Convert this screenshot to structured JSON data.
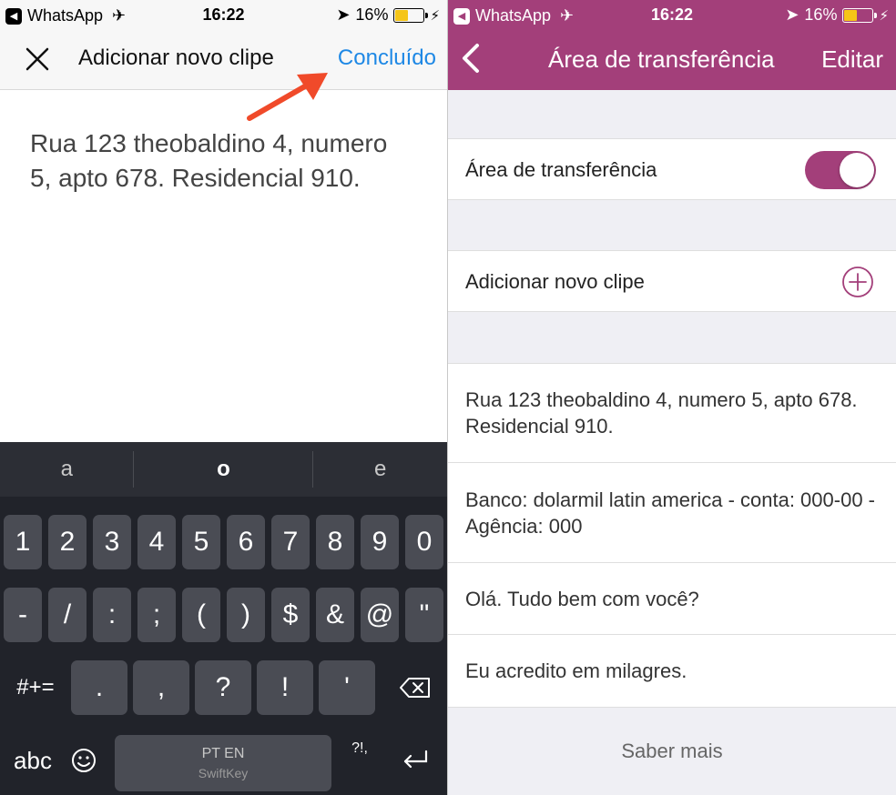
{
  "left": {
    "status": {
      "app": "WhatsApp",
      "time": "16:22",
      "battery": "16%"
    },
    "nav": {
      "title": "Adicionar novo clipe",
      "done_label": "Concluído"
    },
    "clip_text": "Rua 123 theobaldino 4, numero 5, apto 678. Residencial 910.",
    "keyboard": {
      "suggestions": [
        "a",
        "o",
        "e"
      ],
      "row1": [
        "1",
        "2",
        "3",
        "4",
        "5",
        "6",
        "7",
        "8",
        "9",
        "0"
      ],
      "row2": [
        "-",
        "/",
        ":",
        ";",
        "(",
        ")",
        "$",
        "&",
        "@",
        "\""
      ],
      "row3_mode": "#+=",
      "row3": [
        ".",
        ",",
        "?",
        "!",
        "'"
      ],
      "mode_key": "abc",
      "space_lang": "PT EN",
      "space_brand": "SwiftKey",
      "punct_key": "?!,"
    }
  },
  "right": {
    "status": {
      "app": "WhatsApp",
      "time": "16:22",
      "battery": "16%"
    },
    "nav": {
      "title": "Área de transferência",
      "edit_label": "Editar"
    },
    "toggle_row": {
      "label": "Área de transferência",
      "on": true
    },
    "add_row": {
      "label": "Adicionar novo clipe"
    },
    "clips": [
      "Rua 123 theobaldino 4, numero 5, apto 678. Residencial 910.",
      "Banco: dolarmil latin america - conta: 000-00 - Agência: 000",
      "Olá. Tudo bem com você?",
      "Eu acredito em milagres."
    ],
    "footer": "Saber mais"
  },
  "colors": {
    "accent": "#a33f7a",
    "link": "#1e88e5",
    "keyboard_bg": "#21232a",
    "arrow": "#f04a2a"
  }
}
